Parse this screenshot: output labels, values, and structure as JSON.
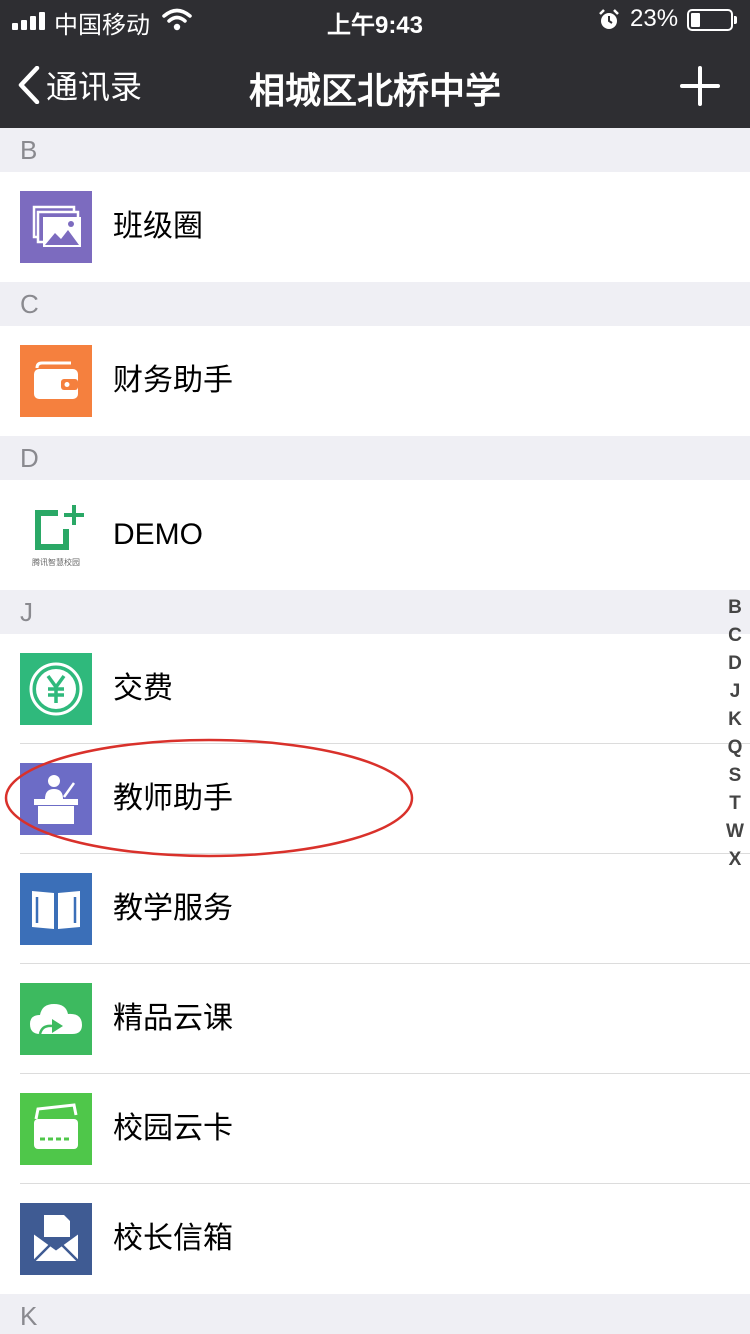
{
  "status": {
    "carrier": "中国移动",
    "time": "上午9:43",
    "battery": "23%",
    "battery_level": 0.23
  },
  "nav": {
    "back_label": "通讯录",
    "title": "相城区北桥中学"
  },
  "sections": [
    {
      "letter": "B",
      "items": [
        {
          "label": "班级圈",
          "icon": "photos-icon",
          "color": "#7c6bbf"
        }
      ]
    },
    {
      "letter": "C",
      "items": [
        {
          "label": "财务助手",
          "icon": "wallet-icon",
          "color": "#f5803e"
        }
      ]
    },
    {
      "letter": "D",
      "items": [
        {
          "label": "DEMO",
          "icon": "smart-campus-logo-icon",
          "color": "#ffffff"
        }
      ]
    },
    {
      "letter": "J",
      "items": [
        {
          "label": "交费",
          "icon": "yuan-icon",
          "color": "#2fb97c"
        },
        {
          "label": "教师助手",
          "icon": "teacher-icon",
          "color": "#6c6cc6"
        },
        {
          "label": "教学服务",
          "icon": "book-icon",
          "color": "#3b6fb8"
        },
        {
          "label": "精品云课",
          "icon": "cloud-play-icon",
          "color": "#3dba5f"
        },
        {
          "label": "校园云卡",
          "icon": "card-icon",
          "color": "#4fc74a"
        },
        {
          "label": "校长信箱",
          "icon": "mailbox-icon",
          "color": "#3f5b93"
        }
      ]
    },
    {
      "letter": "K",
      "items": []
    }
  ],
  "index_letters": [
    "B",
    "C",
    "D",
    "J",
    "K",
    "Q",
    "S",
    "T",
    "W",
    "X"
  ],
  "logo_text": "腾讯智慧校园",
  "colors": {
    "nav_bg": "#2e2e32",
    "highlight": "#d9312b"
  }
}
